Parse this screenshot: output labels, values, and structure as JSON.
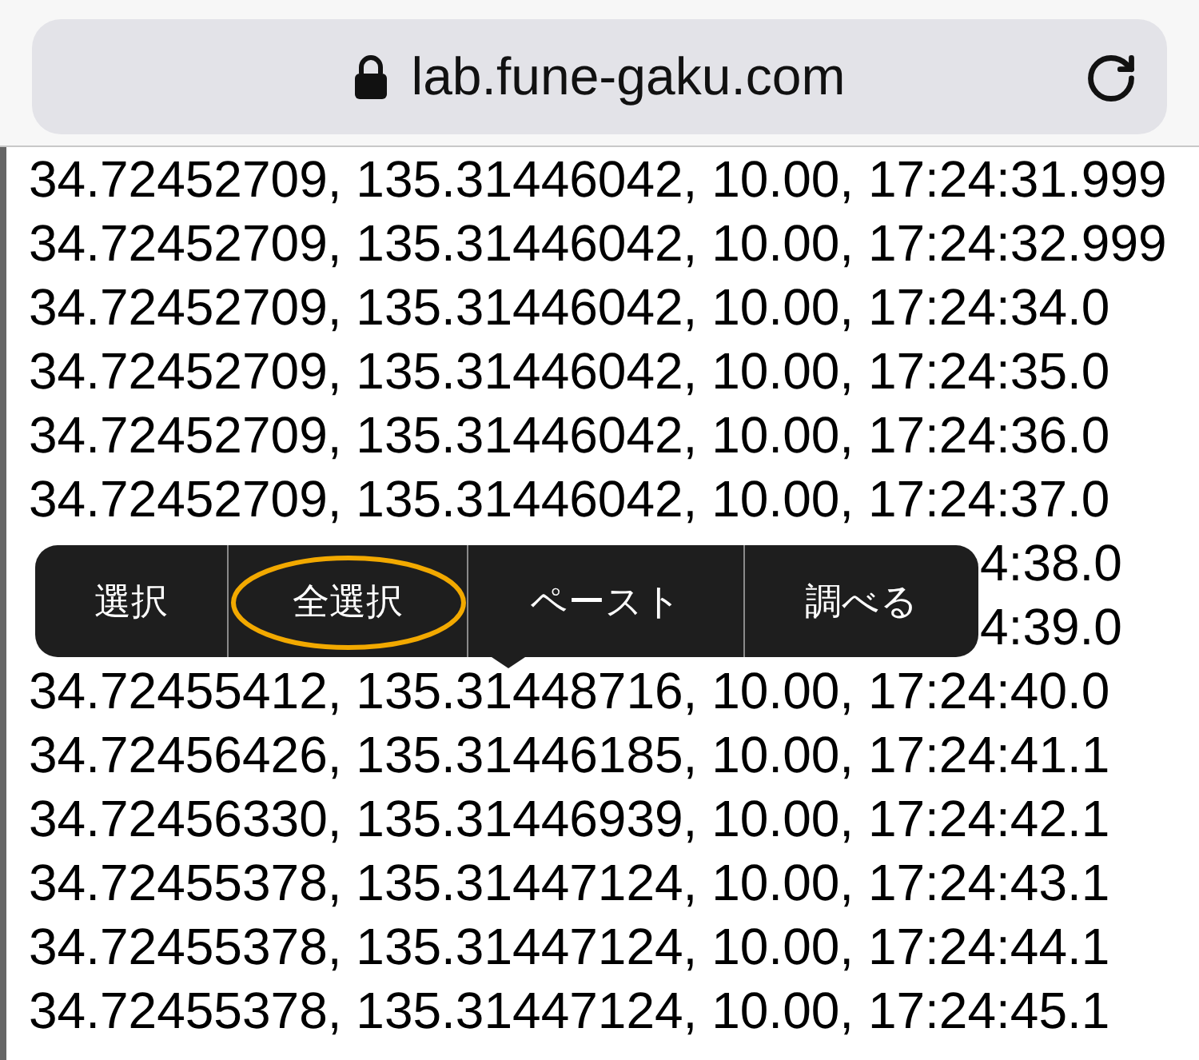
{
  "address_bar": {
    "url": "lab.fune-gaku.com"
  },
  "lines": [
    {
      "kind": "full",
      "text": "34.72452709, 135.31446042, 10.00, 17:24:31.999"
    },
    {
      "kind": "full",
      "text": "34.72452709, 135.31446042, 10.00, 17:24:32.999"
    },
    {
      "kind": "full",
      "text": "34.72452709, 135.31446042, 10.00, 17:24:34.0"
    },
    {
      "kind": "full",
      "text": "34.72452709, 135.31446042, 10.00, 17:24:35.0"
    },
    {
      "kind": "full",
      "text": "34.72452709, 135.31446042, 10.00, 17:24:36.0"
    },
    {
      "kind": "full",
      "text": "34.72452709, 135.31446042, 10.00, 17:24:37.0"
    },
    {
      "kind": "covered",
      "text": "4:38.0"
    },
    {
      "kind": "covered",
      "text": "4:39.0"
    },
    {
      "kind": "full",
      "text": "34.72455412, 135.31448716, 10.00, 17:24:40.0"
    },
    {
      "kind": "full",
      "text": "34.72456426, 135.31446185, 10.00, 17:24:41.1"
    },
    {
      "kind": "full",
      "text": "34.72456330, 135.31446939, 10.00, 17:24:42.1"
    },
    {
      "kind": "full",
      "text": "34.72455378, 135.31447124, 10.00, 17:24:43.1"
    },
    {
      "kind": "full",
      "text": "34.72455378, 135.31447124, 10.00, 17:24:44.1"
    },
    {
      "kind": "full",
      "text": "34.72455378, 135.31447124, 10.00, 17:24:45.1"
    }
  ],
  "context_menu": {
    "items": [
      {
        "label": "選択",
        "circled": false
      },
      {
        "label": "全選択",
        "circled": true
      },
      {
        "label": "ペースト",
        "circled": false
      },
      {
        "label": "調べる",
        "circled": false
      }
    ]
  }
}
